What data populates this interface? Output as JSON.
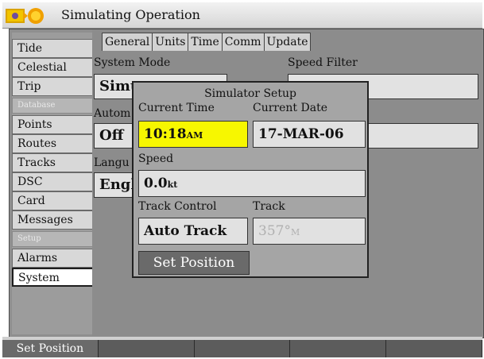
{
  "window": {
    "title": "Simulating Operation"
  },
  "sidebar": {
    "items": [
      {
        "label": "Tide"
      },
      {
        "label": "Celestial"
      },
      {
        "label": "Trip"
      },
      {
        "label": "Database"
      },
      {
        "label": "Points"
      },
      {
        "label": "Routes"
      },
      {
        "label": "Tracks"
      },
      {
        "label": "DSC"
      },
      {
        "label": "Card"
      },
      {
        "label": "Messages"
      },
      {
        "label": "Setup"
      },
      {
        "label": "Alarms"
      },
      {
        "label": "System"
      }
    ]
  },
  "tabs": [
    "General",
    "Units",
    "Time",
    "Comm",
    "Update"
  ],
  "system": {
    "system_mode_label": "System Mode",
    "system_mode_value": "Simu",
    "speed_filter_label": "Speed Filter",
    "auto_label": "Autom",
    "auto_value": "Off",
    "language_label": "Langu",
    "language_value": "Engl"
  },
  "dialog": {
    "title": "Simulator Setup",
    "current_time_label": "Current Time",
    "current_time_value": "10:18",
    "current_time_unit": "AM",
    "current_date_label": "Current Date",
    "current_date_value": "17-MAR-06",
    "speed_label": "Speed",
    "speed_value": "0.0",
    "speed_unit": "kt",
    "track_control_label": "Track Control",
    "track_control_value": "Auto Track",
    "track_label": "Track",
    "track_value": "357°",
    "track_unit": "M",
    "set_position_label": "Set Position"
  },
  "softkeys": [
    "Set Position",
    "",
    "",
    "",
    ""
  ]
}
